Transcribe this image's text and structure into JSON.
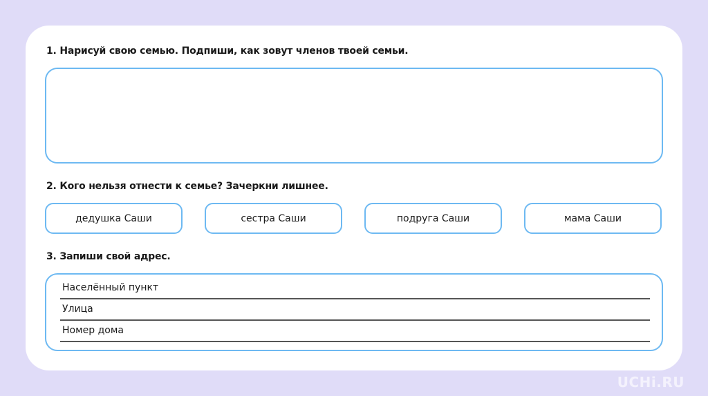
{
  "task1": {
    "title": "1. Нарисуй свою семью. Подпиши, как зовут членов твоей семьи."
  },
  "task2": {
    "title": "2. Кого нельзя отнести к семье? Зачеркни лишнее.",
    "options": [
      "дедушка Саши",
      "сестра Саши",
      "подруга Саши",
      "мама Саши"
    ]
  },
  "task3": {
    "title": "3. Запиши свой адрес.",
    "fields": [
      "Населённый пункт",
      "Улица",
      "Номер дома"
    ]
  },
  "logo": "UCHi.RU",
  "colors": {
    "background": "#e0dcf8",
    "border": "#6db9f2"
  }
}
